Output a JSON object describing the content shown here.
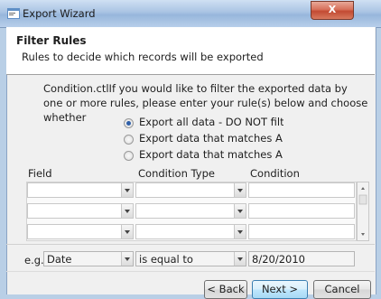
{
  "window": {
    "title": "Export Wizard",
    "close_glyph": "X"
  },
  "header": {
    "title": "Filter Rules",
    "subtitle": "Rules to decide which records will be exported"
  },
  "instructions": "Condition.ctlIf you would like to filter the exported data by one or more rules, please enter your rule(s) below and choose whether",
  "export_options": [
    {
      "label": "Export all data - DO NOT filte",
      "selected": true
    },
    {
      "label": "Export data that matches ANY",
      "selected": false
    },
    {
      "label": "Export data that matches ALL",
      "selected": false
    }
  ],
  "grid": {
    "columns": [
      "Field",
      "Condition Type",
      "Condition"
    ],
    "rows": [
      {
        "field": "",
        "condition_type": "",
        "condition": ""
      },
      {
        "field": "",
        "condition_type": "",
        "condition": ""
      },
      {
        "field": "",
        "condition_type": "",
        "condition": ""
      }
    ]
  },
  "example": {
    "prefix": "e.g.",
    "field": "Date",
    "condition_type": "is equal to",
    "condition": "8/20/2010"
  },
  "buttons": {
    "back": "< Back",
    "next": "Next >",
    "cancel": "Cancel"
  },
  "icons": {
    "window": "export-wizard-icon",
    "close": "close-icon",
    "dropdown": "chevron-down-icon"
  }
}
